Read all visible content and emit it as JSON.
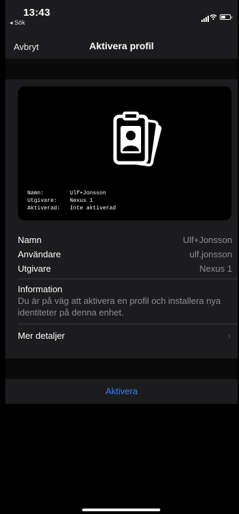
{
  "status_bar": {
    "time": "13:43",
    "back_app": "◂ Sök"
  },
  "nav": {
    "cancel_label": "Avbryt",
    "title": "Aktivera profil"
  },
  "card": {
    "icon": "id-badge-stack-icon",
    "lines": [
      {
        "key": "Namn:",
        "value": "Ulf+Jonsson"
      },
      {
        "key": "Utgivare:",
        "value": "Nexus 1"
      },
      {
        "key": "Aktiverad:",
        "value": "Inte aktiverad"
      }
    ]
  },
  "details": {
    "rows": [
      {
        "label": "Namn",
        "value": "Ulf+Jonsson"
      },
      {
        "label": "Användare",
        "value": "ulf.jonsson"
      },
      {
        "label": "Utgivare",
        "value": "Nexus 1"
      }
    ],
    "info_title": "Information",
    "info_text": "Du är på väg att aktivera en profil och installera nya identiteter på denna enhet.",
    "more_label": "Mer detaljer"
  },
  "action": {
    "activate_label": "Aktivera"
  },
  "colors": {
    "accent": "#2f82f7",
    "panel": "#1c1c1e",
    "secondary_text": "#8e8e93"
  }
}
